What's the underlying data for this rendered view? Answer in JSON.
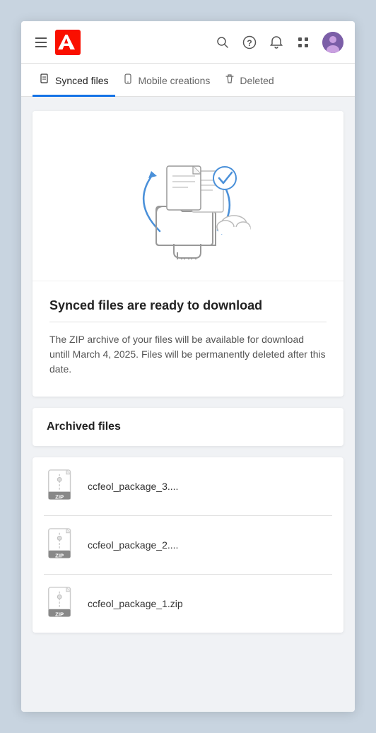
{
  "header": {
    "menu_icon": "hamburger-icon",
    "logo_alt": "Adobe logo",
    "icons": {
      "search": "🔍",
      "help": "?",
      "notifications": "🔔",
      "apps": "⠿"
    }
  },
  "tabs": [
    {
      "id": "synced",
      "label": "Synced files",
      "active": true
    },
    {
      "id": "mobile",
      "label": "Mobile creations",
      "active": false
    },
    {
      "id": "deleted",
      "label": "Deleted",
      "active": false
    }
  ],
  "main": {
    "title": "Synced files are ready to download",
    "description": "The ZIP archive of your files will be available for download untill March 4, 2025. Files will be permanently deleted after this date.",
    "archived_section": {
      "title": "Archived files"
    },
    "files": [
      {
        "name": "ccfeol_package_3...."
      },
      {
        "name": "ccfeol_package_2...."
      },
      {
        "name": "ccfeol_package_1.zip"
      }
    ]
  },
  "colors": {
    "accent_blue": "#1473e6",
    "adobe_red": "#fa0f00"
  }
}
